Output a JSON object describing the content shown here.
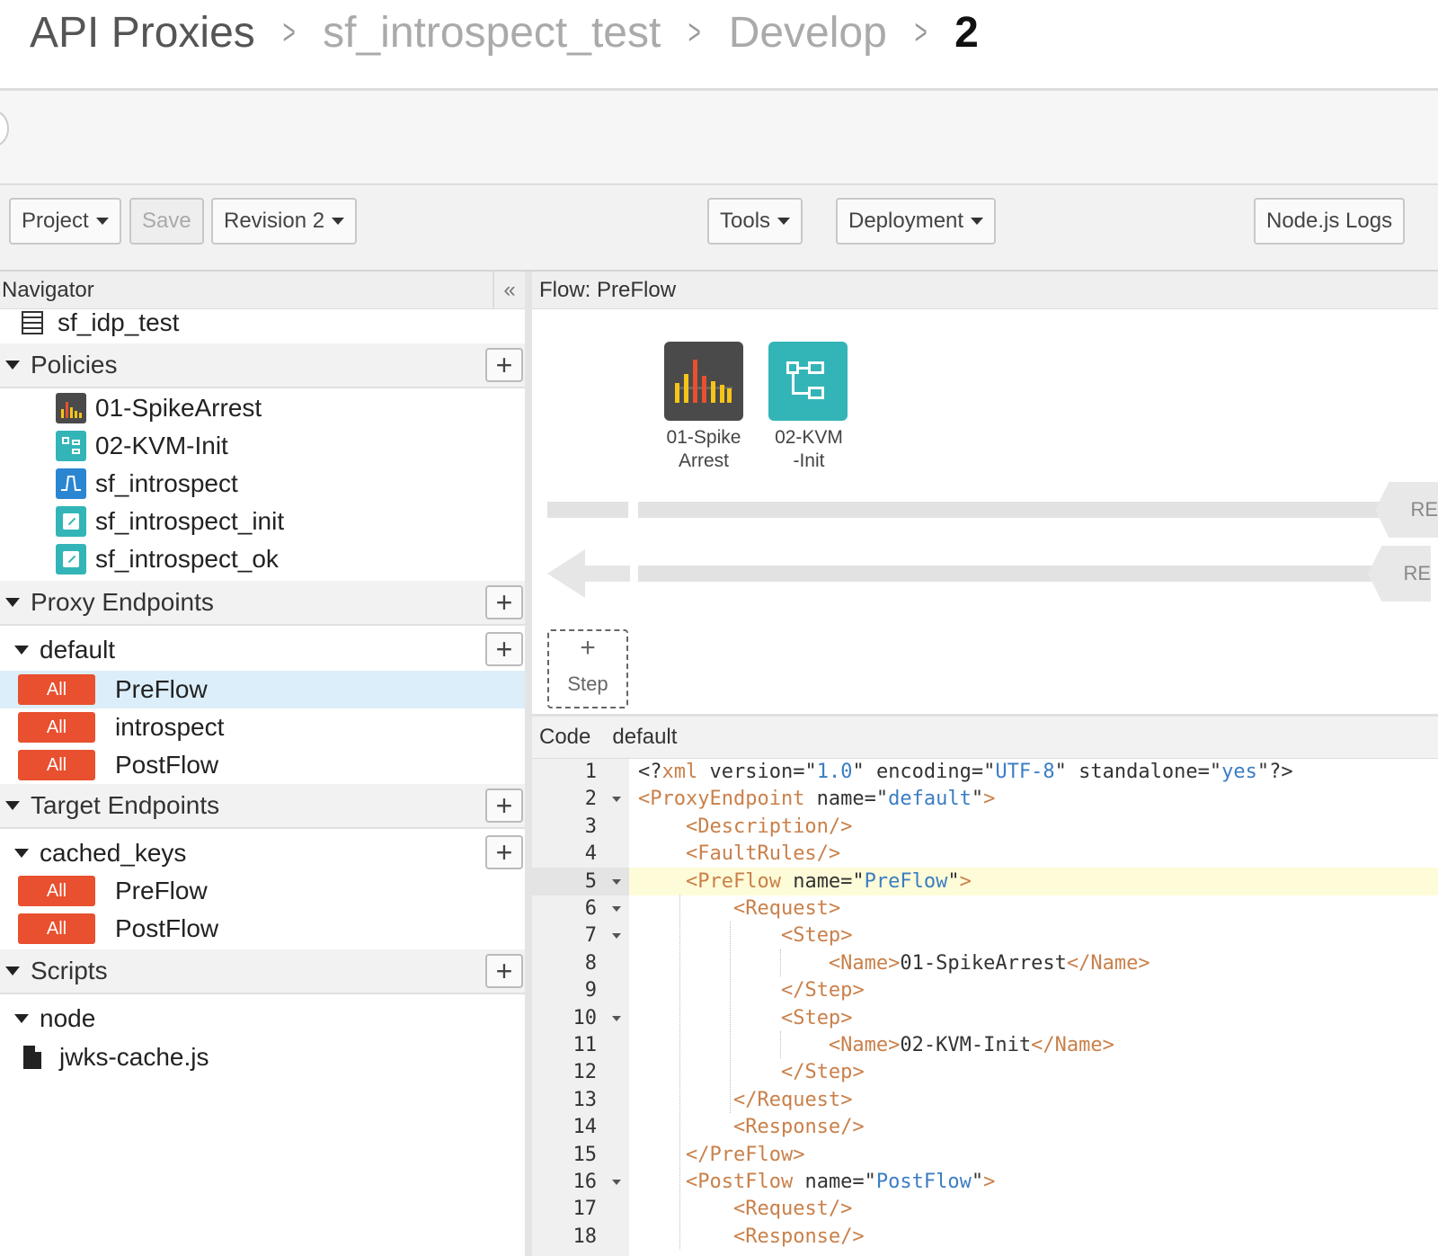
{
  "breadcrumb": {
    "root": "API Proxies",
    "proxy": "sf_introspect_test",
    "section": "Develop",
    "revision": "2"
  },
  "toolbar": {
    "project": "Project",
    "save": "Save",
    "revision": "Revision 2",
    "tools": "Tools",
    "deployment": "Deployment",
    "nodejs_logs": "Node.js Logs"
  },
  "navigator": {
    "title": "Navigator",
    "collapse_glyph": "«",
    "proxy_name": "sf_idp_test",
    "policies_label": "Policies",
    "policies": [
      "01-SpikeArrest",
      "02-KVM-Init",
      "sf_introspect",
      "sf_introspect_init",
      "sf_introspect_ok"
    ],
    "proxy_endpoints_label": "Proxy Endpoints",
    "proxy_endpoint": {
      "name": "default",
      "flows": [
        {
          "badge": "All",
          "name": "PreFlow"
        },
        {
          "badge": "All",
          "name": "introspect"
        },
        {
          "badge": "All",
          "name": "PostFlow"
        }
      ]
    },
    "target_endpoints_label": "Target Endpoints",
    "target_endpoint": {
      "name": "cached_keys",
      "flows": [
        {
          "badge": "All",
          "name": "PreFlow"
        },
        {
          "badge": "All",
          "name": "PostFlow"
        }
      ]
    },
    "scripts_label": "Scripts",
    "scripts_folder": "node",
    "script_file": "jwks-cache.js"
  },
  "flow": {
    "title": "Flow: PreFlow",
    "steps": [
      {
        "line1": "01-Spike",
        "line2": "Arrest"
      },
      {
        "line1": "02-KVM",
        "line2": "-Init"
      }
    ],
    "request_end": "RE",
    "response_end": "RE",
    "add_step_plus": "+",
    "add_step": "Step"
  },
  "code": {
    "tab_code": "Code",
    "tab_name": "default",
    "lines": [
      "<?xml version=\"1.0\" encoding=\"UTF-8\" standalone=\"yes\"?>",
      "<ProxyEndpoint name=\"default\">",
      "    <Description/>",
      "    <FaultRules/>",
      "    <PreFlow name=\"PreFlow\">",
      "        <Request>",
      "            <Step>",
      "                <Name>01-SpikeArrest</Name>",
      "            </Step>",
      "            <Step>",
      "                <Name>02-KVM-Init</Name>",
      "            </Step>",
      "        </Request>",
      "        <Response/>",
      "    </PreFlow>",
      "    <PostFlow name=\"PostFlow\">",
      "        <Request/>",
      "        <Response/>"
    ],
    "line_numbers": [
      "1",
      "2",
      "3",
      "4",
      "5",
      "6",
      "7",
      "8",
      "9",
      "10",
      "11",
      "12",
      "13",
      "14",
      "15",
      "16",
      "17",
      "18"
    ]
  },
  "colors": {
    "badge": "#e8502f",
    "selected_row": "#dceef9",
    "spike_tile": "#4a4a4a",
    "kvm_tile": "#33b5b8",
    "js_icon": "#2b86d1"
  }
}
